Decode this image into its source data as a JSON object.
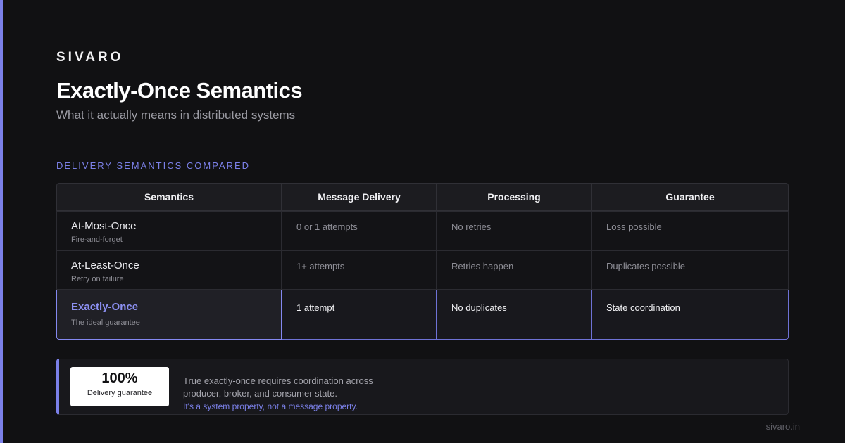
{
  "brand": "SIVARO",
  "title": "Exactly-Once Semantics",
  "subtitle": "What it actually means in distributed systems",
  "section_label": "DELIVERY SEMANTICS COMPARED",
  "table": {
    "headers": [
      "Semantics",
      "Message Delivery",
      "Processing",
      "Guarantee"
    ],
    "rows": [
      {
        "name": "At-Most-Once",
        "desc": "Fire-and-forget",
        "delivery": "0 or 1 attempts",
        "processing": "No retries",
        "guarantee": "Loss possible"
      },
      {
        "name": "At-Least-Once",
        "desc": "Retry on failure",
        "delivery": "1+ attempts",
        "processing": "Retries happen",
        "guarantee": "Duplicates possible"
      },
      {
        "name": "Exactly-Once",
        "desc": "The ideal guarantee",
        "delivery": "1 attempt",
        "processing": "No duplicates",
        "guarantee": "State coordination"
      }
    ]
  },
  "callout": {
    "stat_value": "100%",
    "stat_label": "Delivery guarantee",
    "text_line1": "True exactly-once requires coordination across",
    "text_line2": "producer, broker, and consumer state.",
    "emphasis": "It's a system property, not a message property."
  },
  "footer": "sivaro.in",
  "colors": {
    "accent": "#7b80e8",
    "background": "#111113"
  }
}
